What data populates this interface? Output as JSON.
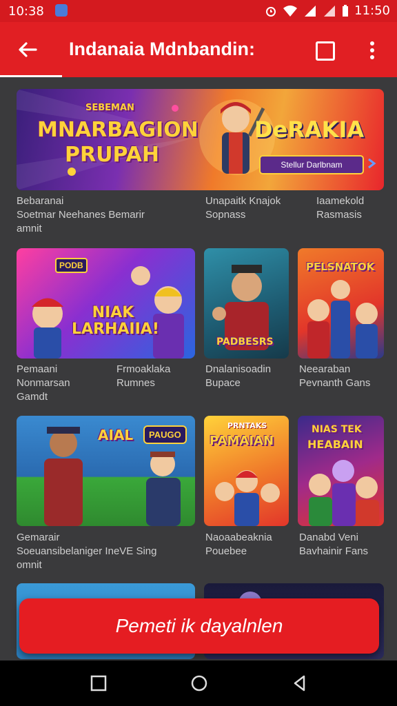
{
  "status_bar": {
    "time": "10:38",
    "clock": "11:50"
  },
  "app_bar": {
    "title": "Indanaia Mdnbandin:"
  },
  "banner": {
    "headline_1": "MNARBAGION",
    "headline_2": "PRUPAH",
    "tagline": "SEBEMAN",
    "right_title": "DeRAKIA",
    "button": "Stellur Darlbnam"
  },
  "banner_meta": [
    {
      "line1": "Bebaranai",
      "line2": "Soetmar Neehanes Bemarir",
      "line3": "amnit"
    },
    {
      "line1": "Unapaitk Knajok",
      "line2": "Sopnass"
    },
    {
      "line1": "Iaamekold",
      "line2": "Rasmasis"
    }
  ],
  "row1": [
    {
      "art": "NIAK LARHAIIA!",
      "badge": "PODB",
      "line1": "Pemaani",
      "line2": "Nonmarsan",
      "line3": "Gamdt",
      "col2_line1": "Frmoaklaka",
      "col2_line2": "Rumnes"
    },
    {
      "art": "PADBESRS",
      "line1": "Dnalanisoadin",
      "line2": "Bupace"
    },
    {
      "art": "PELSNATOK",
      "line1": "Neearaban",
      "line2": "Pevnanth Gans"
    }
  ],
  "row2": [
    {
      "art": "AIAL",
      "badge": "PAUGO",
      "line1": "Gemarair",
      "line2": "Soeuansibelaniger  IneVE Sing",
      "line3": "omnit"
    },
    {
      "art": "PAMAIAN",
      "tag": "PRNTAKS",
      "line1": "Naoaabeaknia",
      "line2": "Pouebee"
    },
    {
      "art": "HEABAIN",
      "tag": "NIAS TEK",
      "line1": "Danabd Veni",
      "line2": "Bavhainir Fans"
    }
  ],
  "cta": {
    "label": "Pemeti ik dayalnlen"
  },
  "colors": {
    "accent": "#e11f23",
    "background": "#3a3a3c"
  }
}
